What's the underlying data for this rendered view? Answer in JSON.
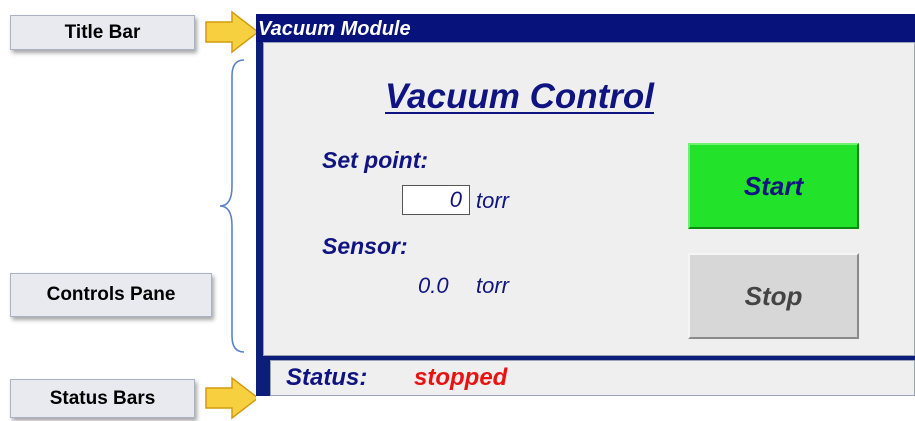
{
  "callouts": {
    "title_bar": "Title Bar",
    "controls_pane": "Controls Pane",
    "status_bars": "Status Bars"
  },
  "window": {
    "title": "Vacuum Module"
  },
  "controls": {
    "heading": "Vacuum Control",
    "setpoint_label": "Set point:",
    "setpoint_value": "0",
    "setpoint_unit": "torr",
    "sensor_label": "Sensor:",
    "sensor_value": "0.0",
    "sensor_unit": "torr",
    "start_label": "Start",
    "stop_label": "Stop"
  },
  "status": {
    "label": "Status:",
    "value": "stopped"
  },
  "colors": {
    "titlebar": "#07137a",
    "text_primary": "#101480",
    "start_button": "#22e32a",
    "stop_button": "#d7d7d7",
    "status_value": "#e81212",
    "callout_arrow": "#f7d040"
  }
}
